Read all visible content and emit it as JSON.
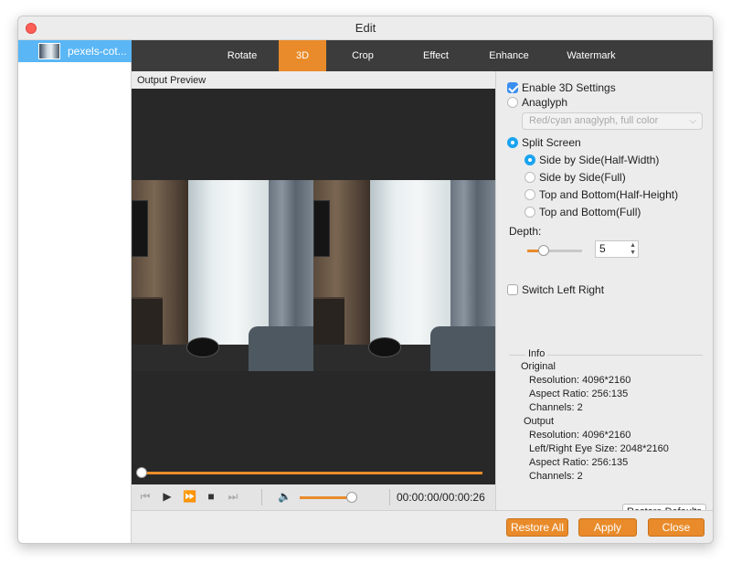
{
  "window": {
    "title": "Edit"
  },
  "sidebar": {
    "file_name": "pexels-cot..."
  },
  "tabs": [
    "Rotate",
    "3D",
    "Crop",
    "Effect",
    "Enhance",
    "Watermark"
  ],
  "active_tab": "3D",
  "preview": {
    "label": "Output Preview",
    "progress": 0.0
  },
  "playback": {
    "timecode": "00:00:00/00:00:26",
    "volume": 0.8
  },
  "settings": {
    "enable_3d": {
      "label": "Enable 3D Settings",
      "checked": true
    },
    "anaglyph": {
      "label": "Anaglyph",
      "checked": false,
      "select_value": "Red/cyan anaglyph, full color"
    },
    "split_screen": {
      "label": "Split Screen",
      "checked": true
    },
    "split_options": [
      {
        "label": "Side by Side(Half-Width)",
        "checked": true
      },
      {
        "label": "Side by Side(Full)",
        "checked": false
      },
      {
        "label": "Top and Bottom(Half-Height)",
        "checked": false
      },
      {
        "label": "Top and Bottom(Full)",
        "checked": false
      }
    ],
    "depth": {
      "label": "Depth:",
      "value": "5"
    },
    "switch_lr": {
      "label": "Switch Left Right",
      "checked": false
    }
  },
  "info": {
    "heading": "Info",
    "original": {
      "heading": "Original",
      "resolution": "Resolution: 4096*2160",
      "aspect": "Aspect Ratio: 256:135",
      "channels": "Channels: 2"
    },
    "output": {
      "heading": "Output",
      "resolution": "Resolution: 4096*2160",
      "eye_size": "Left/Right Eye Size: 2048*2160",
      "aspect": "Aspect Ratio: 256:135",
      "channels": "Channels: 2"
    },
    "restore_defaults": "Restore Defaults"
  },
  "footer": {
    "restore_all": "Restore All",
    "apply": "Apply",
    "close": "Close"
  },
  "colors": {
    "accent": "#e98b2a",
    "selection": "#5ab6f5",
    "radio": "#1aa4f0",
    "checkbox": "#3a8ef0"
  }
}
